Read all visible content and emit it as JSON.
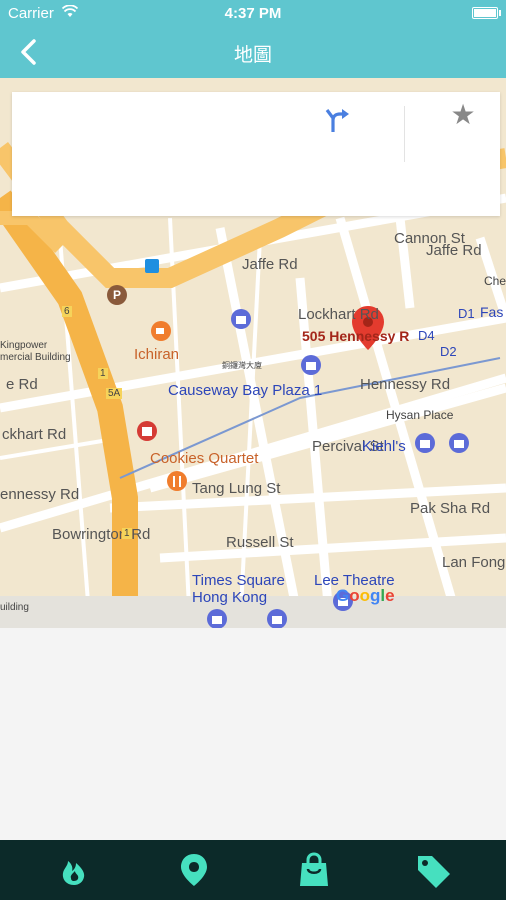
{
  "status_bar": {
    "carrier": "Carrier",
    "time": "4:37 PM"
  },
  "nav": {
    "title": "地圖",
    "back_icon": "chevron-left-icon"
  },
  "info_card": {
    "directions_icon": "directions-icon",
    "favorite_icon": "star-icon",
    "star_glyph": "★"
  },
  "map": {
    "streets": {
      "jaffe_rd_1": "Jaffe Rd",
      "jaffe_rd_2": "Jaffe Rd",
      "lockhart_rd_1": "Lockhart Rd",
      "lockhart_rd_2": "ckhart Rd",
      "hennessy_rd_1": "Hennessy Rd",
      "hennessy_rd_2": "ennessy Rd",
      "cannon_st": "Cannon St",
      "percival_st": "Percival St",
      "tang_lung_st": "Tang Lung St",
      "russell_st": "Russell St",
      "pak_sha_rd": "Pak Sha Rd",
      "lan_fong": "Lan Fong",
      "bowrington_rd": "Bowrington Rd",
      "e_rd": "e Rd",
      "che": "Che"
    },
    "places": {
      "address": "505 Hennessy R",
      "ichiran": "Ichiran",
      "causeway_bay_plaza": "Causeway Bay Plaza 1",
      "cookies_quartet": "Cookies Quartet",
      "hysan_place": "Hysan Place",
      "kiehls": "Kiehl's",
      "times_square_1": "Times Square",
      "times_square_2": "Hong Kong",
      "lee_theatre": "Lee Theatre",
      "kingpower_1": "Kingpower",
      "kingpower_2": "mercial Building",
      "building": "uilding",
      "small_chinese": "銅鑼灣大廈"
    },
    "exits": {
      "d4": "D4",
      "d1": "D1",
      "d2": "D2",
      "fas": "Fas"
    },
    "road_markers": {
      "r1": "1",
      "r5a": "5A",
      "r6": "6",
      "r1b": "1"
    },
    "google": {
      "g1": "G",
      "g2": "o",
      "g3": "o",
      "g4": "g",
      "g5": "l",
      "g6": "e"
    }
  },
  "tabs": [
    {
      "name": "hot",
      "icon": "flame-icon"
    },
    {
      "name": "location",
      "icon": "location-pin-icon"
    },
    {
      "name": "shopping",
      "icon": "shopping-bag-icon"
    },
    {
      "name": "deals",
      "icon": "tag-icon"
    }
  ],
  "colors": {
    "accent": "#5fc6cf",
    "tabbar": "#0c2a29",
    "tab_icon": "#46e0bf"
  }
}
